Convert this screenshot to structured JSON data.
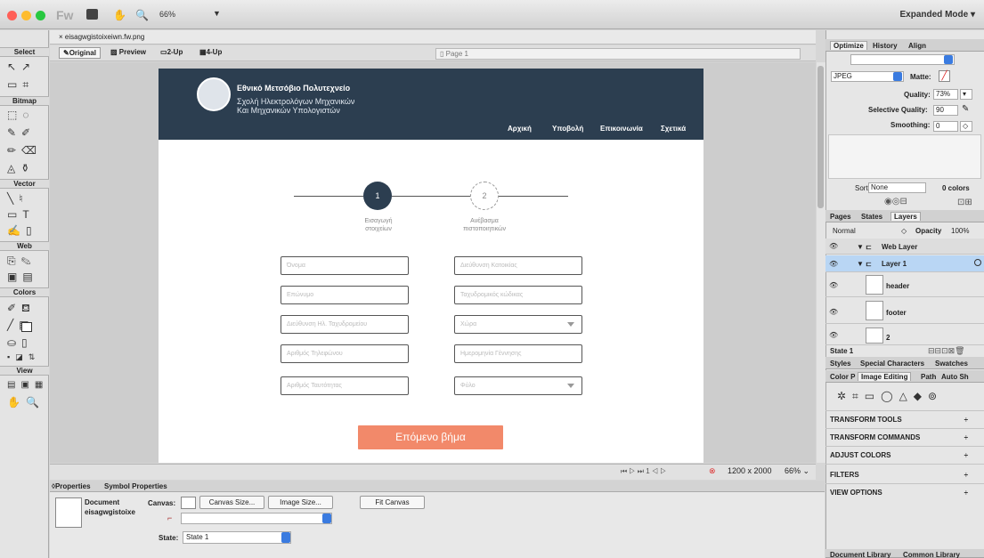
{
  "app": {
    "zoom": "66%",
    "mode": "Expanded Mode",
    "logo": "Fw"
  },
  "tools": {
    "sections": [
      "Select",
      "Bitmap",
      "Vector",
      "Web",
      "Colors",
      "View"
    ]
  },
  "document": {
    "tab": "eisagwgistoixeiwn.fw.png",
    "views": [
      "Original",
      "Preview",
      "2-Up",
      "4-Up"
    ],
    "page": "Page 1"
  },
  "site": {
    "uni": "Εθνικό Μετσόβιο Πολυτεχνείο",
    "school1": "Σχολή Ηλεκτρολόγων Μηχανικών",
    "school2": "Και Μηχανικών Υπολογιστών",
    "nav": [
      "Αρχική",
      "Υποβολή",
      "Επικοινωνία",
      "Σχετικά"
    ],
    "steps": [
      {
        "num": "1",
        "label1": "Εισαγωγή",
        "label2": "στοιχείων"
      },
      {
        "num": "2",
        "label1": "Ανέβασμα",
        "label2": "πιστοποιητικών"
      }
    ],
    "fields_left": [
      "Όνομα",
      "Επώνυμο",
      "Διεύθυνση Ηλ. Ταχυδρομείου",
      "Αριθμός Τηλεφώνου",
      "Αριθμός Ταυτότητας"
    ],
    "fields_right": [
      "Διεύθυνση Κατοικίας",
      "Ταχυδρομικός κώδικας",
      "Χώρα",
      "Ημερομηνία Γέννησης",
      "Φύλο"
    ],
    "next": "Επόμενο βήμα"
  },
  "status": {
    "nav": "⏮ ▷ ⏭ 1 ◁ ▷",
    "size": "1200 x 2000",
    "zoom": "66%"
  },
  "props": {
    "tabs": [
      "Properties",
      "Symbol Properties"
    ],
    "doc": "Document",
    "docname": "eisagwgistoixe",
    "canvas": "Canvas:",
    "canvas_size": "Canvas Size...",
    "image_size": "Image Size...",
    "fit": "Fit Canvas",
    "state_label": "State:",
    "state": "State 1"
  },
  "optimize": {
    "tabs": [
      "Optimize",
      "History",
      "Align"
    ],
    "format": "JPEG",
    "matte": "Matte:",
    "quality": "Quality:",
    "quality_v": "73%",
    "selq": "Selective Quality:",
    "selq_v": "90",
    "smooth": "Smoothing:",
    "smooth_v": "0",
    "sort": "Sort:",
    "sort_v": "None",
    "colors": "0 colors"
  },
  "layers": {
    "tabs": [
      "Pages",
      "States",
      "Layers"
    ],
    "blend": "Normal",
    "opacity": "Opacity",
    "opacity_v": "100%",
    "items": [
      "Web Layer",
      "Layer 1",
      "header",
      "footer",
      "2"
    ],
    "state": "State 1"
  },
  "styles": {
    "tabs": [
      "Styles",
      "Special Characters",
      "Swatches"
    ],
    "tabs2": [
      "Color P",
      "Image Editing",
      "Path",
      "Auto Sh"
    ],
    "sections": [
      "TRANSFORM TOOLS",
      "TRANSFORM COMMANDS",
      "ADJUST COLORS",
      "FILTERS",
      "VIEW OPTIONS"
    ]
  },
  "library": {
    "tabs": [
      "Document Library",
      "Common Library"
    ]
  }
}
